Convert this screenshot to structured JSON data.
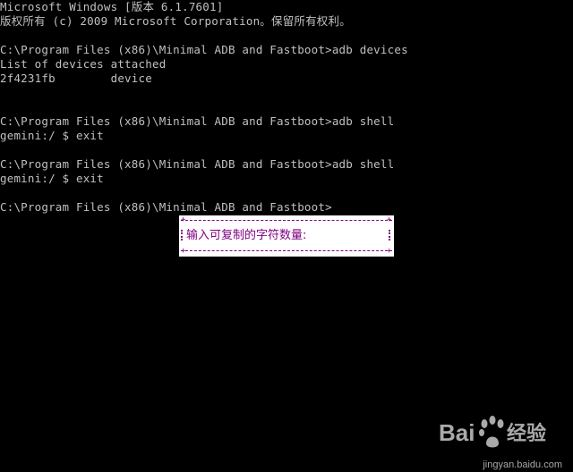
{
  "console": {
    "lines": [
      "Microsoft Windows [版本 6.1.7601]",
      "版权所有 (c) 2009 Microsoft Corporation。保留所有权利。",
      "",
      "C:\\Program Files (x86)\\Minimal ADB and Fastboot>adb devices",
      "List of devices attached",
      "2f4231fb        device",
      "",
      "",
      "C:\\Program Files (x86)\\Minimal ADB and Fastboot>adb shell",
      "gemini:/ $ exit",
      "",
      "C:\\Program Files (x86)\\Minimal ADB and Fastboot>adb shell",
      "gemini:/ $ exit",
      "",
      "C:\\Program Files (x86)\\Minimal ADB and Fastboot>"
    ],
    "text_color": "#c0c0c0",
    "background": "#000000"
  },
  "popup": {
    "label": "输入可复制的字符数量:",
    "accent": "#800080"
  },
  "watermark": {
    "brand": "Bai经验",
    "domain": "jingyan.baidu.com"
  }
}
